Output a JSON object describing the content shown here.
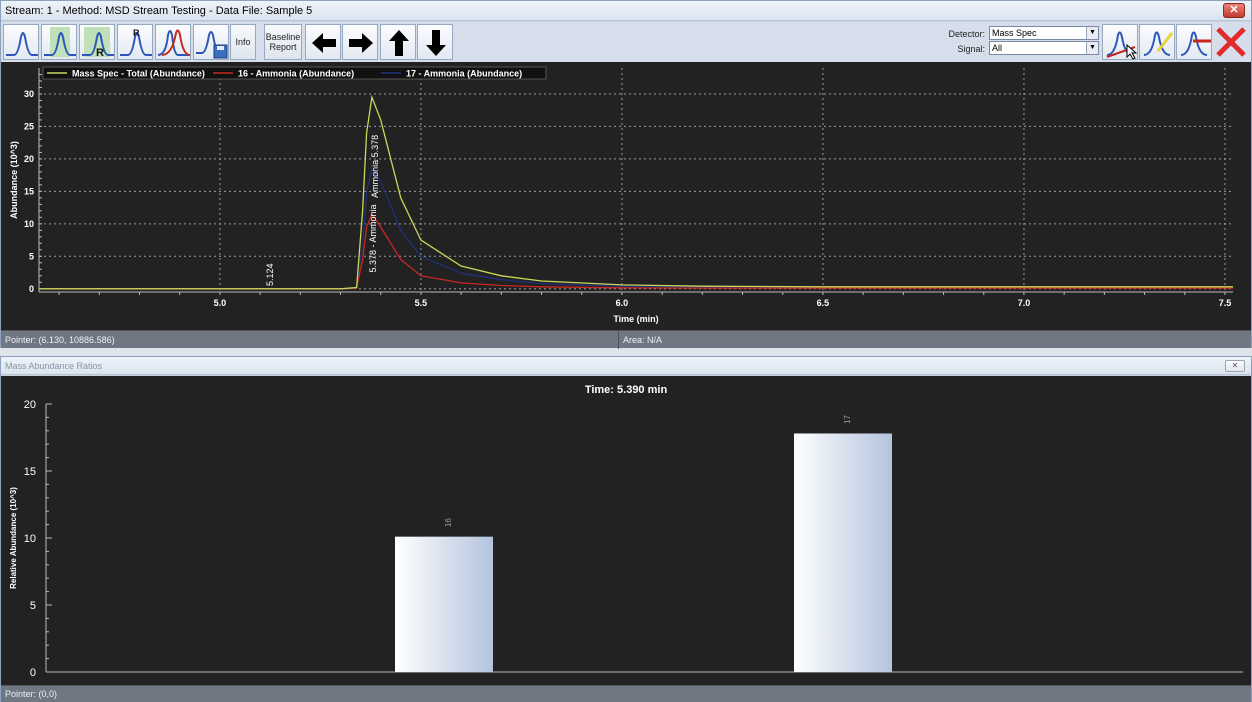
{
  "window": {
    "title": "Stream: 1 - Method: MSD Stream Testing - Data File: Sample 5",
    "close_glyph": "✕"
  },
  "toolbar": {
    "info_label": "Info",
    "baseline_report_label": "Baseline Report",
    "detector_label": "Detector:",
    "detector_value": "Mass Spec",
    "signal_label": "Signal:",
    "signal_value": "All",
    "icons": [
      "peak-view-icon",
      "peak-fill-icon",
      "retention-time-icon",
      "retention-time-marker-icon",
      "overlay-peaks-icon",
      "save-chromatogram-icon",
      "arrow-left-icon",
      "arrow-right-icon",
      "arrow-up-icon",
      "arrow-down-icon",
      "manual-baseline-icon",
      "edit-baseline-icon",
      "clear-baseline-icon",
      "delete-icon"
    ]
  },
  "chromatogram": {
    "legend": [
      "Mass Spec - Total (Abundance)",
      "16 - Ammonia (Abundance)",
      "17 - Ammonia (Abundance)"
    ],
    "colors": {
      "total": "#c8d85a",
      "m16": "#c62820",
      "m17": "#20307a",
      "background": "#222222"
    },
    "ylabel": "Abundance (10^3)",
    "xlabel": "Time (min)",
    "xlim": [
      4.55,
      7.52
    ],
    "ylim": [
      -0.5,
      34
    ],
    "x_ticks": [
      "5.0",
      "5.5",
      "6.0",
      "6.5",
      "7.0",
      "7.5"
    ],
    "y_ticks": [
      "0",
      "5",
      "10",
      "15",
      "20",
      "25",
      "30"
    ],
    "peak_labels": [
      "5.124",
      "5.378 - Ammonia",
      "Ammonia 5.378"
    ],
    "pointer_status": "Pointer: (6.130, 10886.586)",
    "area_status": "Area: N/A"
  },
  "chart_data": [
    {
      "type": "line",
      "series": [
        {
          "name": "Mass Spec - Total (Abundance)",
          "x": [
            4.55,
            5.3,
            5.34,
            5.355,
            5.365,
            5.378,
            5.4,
            5.45,
            5.5,
            5.6,
            5.7,
            5.8,
            6.0,
            6.2,
            6.5,
            7.0,
            7.52
          ],
          "y": [
            0,
            0,
            0.2,
            12,
            24,
            29.5,
            26,
            14,
            7.5,
            3.5,
            2,
            1.2,
            0.6,
            0.4,
            0.3,
            0.3,
            0.3
          ]
        },
        {
          "name": "16 - Ammonia (Abundance)",
          "x": [
            4.55,
            5.3,
            5.34,
            5.355,
            5.365,
            5.378,
            5.4,
            5.45,
            5.5,
            5.6,
            5.7,
            5.8,
            6.0,
            6.2,
            6.5,
            7.0,
            7.52
          ],
          "y": [
            0,
            0,
            0.1,
            4.5,
            9.5,
            11.5,
            9.5,
            4.5,
            2,
            0.9,
            0.5,
            0.3,
            0.15,
            0.1,
            0.1,
            0.1,
            0.1
          ]
        },
        {
          "name": "17 - Ammonia (Abundance)",
          "x": [
            4.55,
            5.3,
            5.34,
            5.355,
            5.365,
            5.378,
            5.4,
            5.45,
            5.5,
            5.6,
            5.7,
            5.8,
            6.0,
            6.2,
            6.5,
            7.0,
            7.52
          ],
          "y": [
            0,
            0,
            0.1,
            7,
            15,
            18.5,
            16.5,
            9,
            5,
            2.4,
            1.4,
            0.8,
            0.4,
            0.3,
            0.2,
            0.2,
            0.2
          ]
        }
      ],
      "xlabel": "Time (min)",
      "ylabel": "Abundance (10^3)",
      "xlim": [
        4.55,
        7.52
      ],
      "ylim": [
        -0.5,
        34
      ],
      "grid": true,
      "legend": "top-left"
    },
    {
      "type": "bar",
      "title": "Time: 5.390 min",
      "categories": [
        "16",
        "17"
      ],
      "values": [
        10.1,
        17.8
      ],
      "ylabel": "Relative Abundance (10^3)",
      "ylim": [
        0,
        20
      ],
      "y_ticks": [
        "0",
        "5",
        "10",
        "15",
        "20"
      ]
    }
  ],
  "ratios_window": {
    "title": "Mass Abundance Ratios",
    "close_glyph": "✕",
    "pointer_status": "Pointer: (0,0)"
  }
}
